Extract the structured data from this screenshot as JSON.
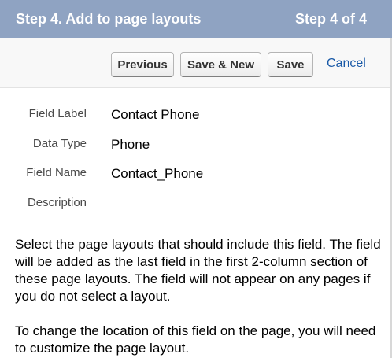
{
  "header": {
    "title": "Step 4. Add to page layouts",
    "step_indicator": "Step 4 of 4"
  },
  "toolbar": {
    "previous_label": "Previous",
    "save_new_label": "Save & New",
    "save_label": "Save",
    "cancel_label": "Cancel"
  },
  "details": {
    "field_label": {
      "label": "Field Label",
      "value": "Contact Phone"
    },
    "data_type": {
      "label": "Data Type",
      "value": "Phone"
    },
    "field_name": {
      "label": "Field Name",
      "value": "Contact_Phone"
    },
    "description": {
      "label": "Description",
      "value": ""
    }
  },
  "instructions": {
    "paragraph_1": "Select the page layouts that should include this field. The field will be added as the last field in the first 2-column section of these page layouts. The field will not appear on any pages if you do not select a layout.",
    "paragraph_2": "To change the location of this field on the page, you will need to customize the page layout."
  },
  "colors": {
    "header_background": "#8fa3c2",
    "link": "#1a5aa8"
  }
}
